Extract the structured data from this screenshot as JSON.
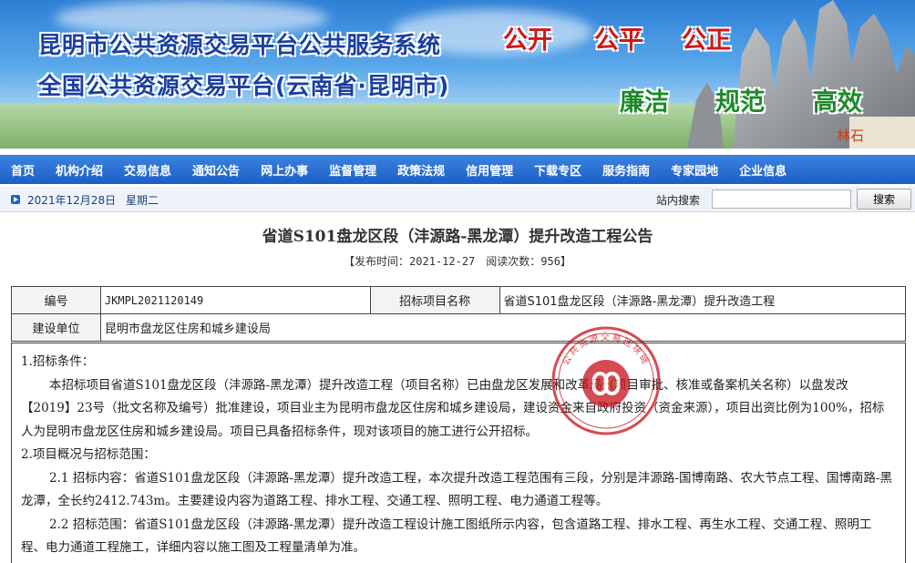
{
  "banner": {
    "title_line1": "昆明市公共资源交易平台公共服务系统",
    "title_line2": "全国公共资源交易平台(云南省·昆明市)",
    "slogan_top": [
      "公开",
      "公平",
      "公正"
    ],
    "slogan_bottom": [
      "廉洁",
      "规范",
      "高效"
    ],
    "stone_mark": "林石"
  },
  "nav": {
    "items": [
      "首页",
      "机构介绍",
      "交易信息",
      "通知公告",
      "网上办事",
      "监督管理",
      "政策法规",
      "信用管理",
      "下载专区",
      "服务指南",
      "专家园地",
      "企业信息"
    ]
  },
  "infobar": {
    "date": "2021年12月28日",
    "weekday": "星期二",
    "search_label": "站内搜索",
    "search_value": "",
    "search_button": "搜索"
  },
  "article": {
    "title": "省道S101盘龙区段（沣源路-黑龙潭）提升改造工程公告",
    "meta": "【发布时间：2021-12-27　阅读次数：956】",
    "table": {
      "row1": {
        "label_no": "编号",
        "value_no": "JKMPL2021120149",
        "label_project": "招标项目名称",
        "value_project": "省道S101盘龙区段（沣源路-黑龙潭）提升改造工程"
      },
      "row2": {
        "label_unit": "建设单位",
        "value_unit": "昆明市盘龙区住房和城乡建设局"
      }
    },
    "content": {
      "h1": "1.招标条件：",
      "p1": "本招标项目省道S101盘龙区段（沣源路-黑龙潭）提升改造工程（项目名称）已由盘龙区发展和改革局（项目审批、核准或备案机关名称）以盘发改【2019】23号（批文名称及编号）批准建设，项目业主为昆明市盘龙区住房和城乡建设局，建设资金来自政府投资（资金来源），项目出资比例为100%，招标人为昆明市盘龙区住房和城乡建设局。项目已具备招标条件，现对该项目的施工进行公开招标。",
      "h2": "2.项目概况与招标范围：",
      "p2": "2.1 招标内容：省道S101盘龙区段（沣源路-黑龙潭）提升改造工程，本次提升改造工程范围有三段，分别是沣源路-国博南路、农大节点工程、国博南路-黑龙潭，全长约2412.743m。主要建设内容为道路工程、排水工程、交通工程、照明工程、电力通道工程等。",
      "p3": "2.2 招标范围：省道S101盘龙区段（沣源路-黑龙潭）提升改造工程设计施工图纸所示内容，包含道路工程、排水工程、再生水工程、交通工程、照明工程、电力通道工程施工，详细内容以施工图及工程量清单为准。"
    },
    "seal_text": "公共资源交易区块链"
  },
  "colors": {
    "nav_bg": "#1b5fc7",
    "title_blue": "#1b3f9e",
    "slogan_red": "#d01818",
    "slogan_green": "#1e8a2a",
    "seal_red": "#c8101a"
  }
}
